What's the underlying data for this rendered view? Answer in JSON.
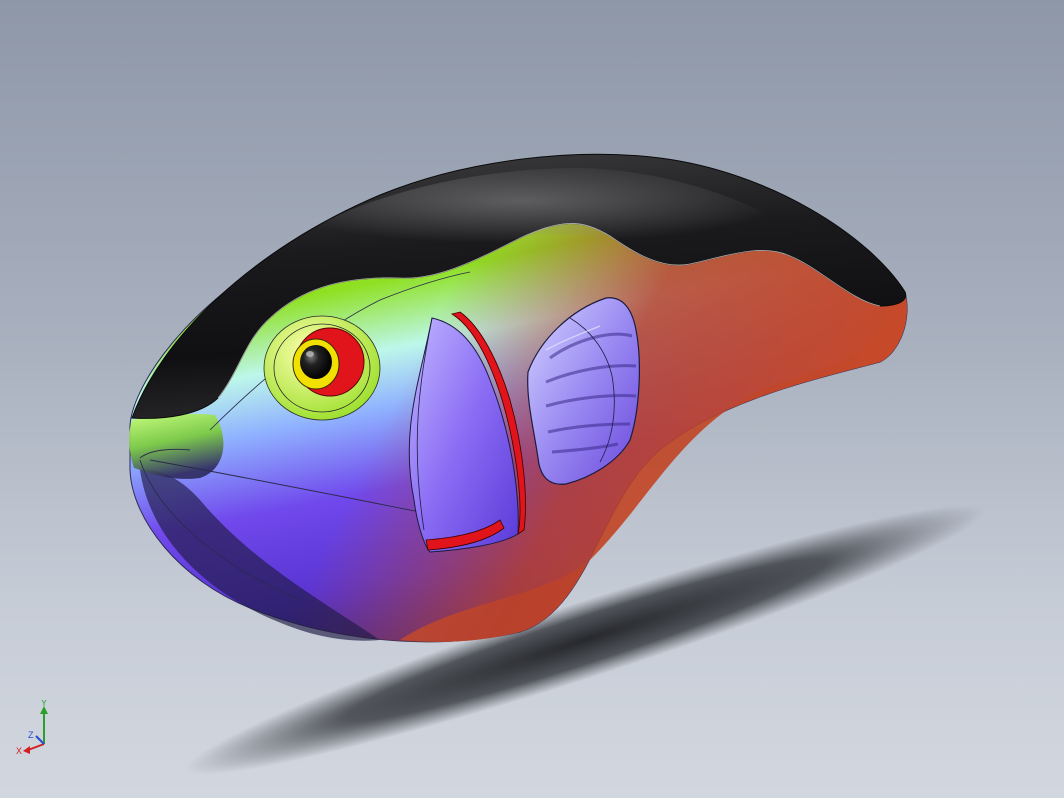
{
  "viewport": {
    "background_top": "#8e97a8",
    "background_bottom": "#d2d7df"
  },
  "model": {
    "body_colors": {
      "back": "#1c1c1e",
      "upper": "#86e21a",
      "middle": "#8fb4ff",
      "lower": "#6a3ee0",
      "belly": "#c0452a"
    },
    "eye_colors": {
      "pupil": "#111111",
      "ring_inner": "#f2e000",
      "ring_outer": "#e0141a"
    }
  },
  "triad": {
    "y_label": "Y",
    "x_label": "X",
    "z_label": "Z",
    "y_color": "#2aa02a",
    "x_color": "#d42020",
    "z_color": "#2a4ad4"
  }
}
